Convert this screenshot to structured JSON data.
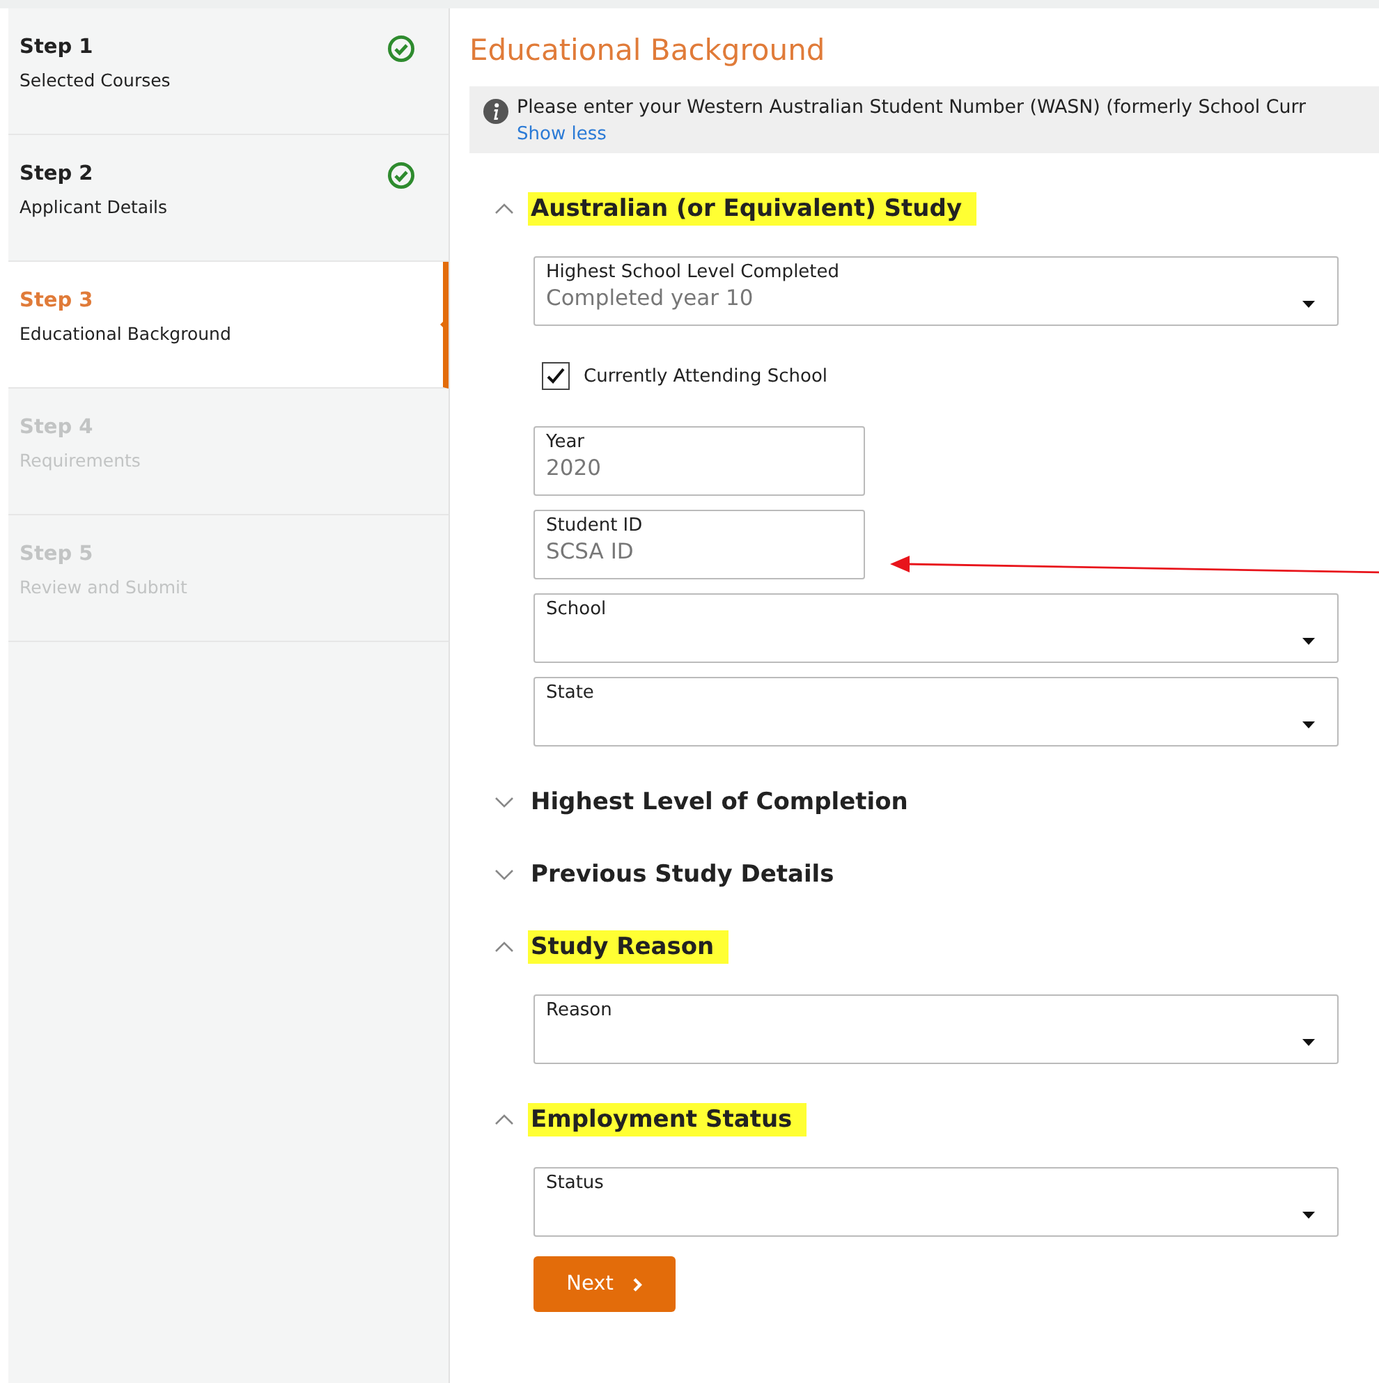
{
  "steps": [
    {
      "title": "Step 1",
      "subtitle": "Selected Courses",
      "completed": true,
      "selected": false,
      "disabled": false
    },
    {
      "title": "Step 2",
      "subtitle": "Applicant Details",
      "completed": true,
      "selected": false,
      "disabled": false
    },
    {
      "title": "Step 3",
      "subtitle": "Educational Background",
      "completed": false,
      "selected": true,
      "disabled": false
    },
    {
      "title": "Step 4",
      "subtitle": "Requirements",
      "completed": false,
      "selected": false,
      "disabled": true
    },
    {
      "title": "Step 5",
      "subtitle": "Review and Submit",
      "completed": false,
      "selected": false,
      "disabled": true
    }
  ],
  "page_title": "Educational Background",
  "info": {
    "text": "Please enter your Western Australian Student Number (WASN) (formerly School Curr",
    "link": "Show less"
  },
  "sections": [
    {
      "title": "Australian (or Equivalent) Study",
      "expanded": true,
      "highlighted": true,
      "fields": [
        {
          "kind": "select",
          "label": "Highest School Level Completed",
          "value": "Completed year 10"
        },
        {
          "kind": "checkbox",
          "label": "Currently Attending School",
          "checked": true
        },
        {
          "kind": "text",
          "label": "Year",
          "value": "2020"
        },
        {
          "kind": "text",
          "label": "Student ID",
          "placeholder": "SCSA ID"
        },
        {
          "kind": "select",
          "label": "School"
        },
        {
          "kind": "select",
          "label": "State"
        }
      ]
    },
    {
      "title": "Highest Level of Completion",
      "expanded": false,
      "highlighted": false
    },
    {
      "title": "Previous Study Details",
      "expanded": false,
      "highlighted": false
    },
    {
      "title": "Study Reason",
      "expanded": true,
      "highlighted": true,
      "fields": [
        {
          "kind": "select",
          "label": "Reason"
        }
      ]
    },
    {
      "title": "Employment Status",
      "expanded": true,
      "highlighted": true,
      "fields": [
        {
          "kind": "select",
          "label": "Status"
        }
      ]
    }
  ],
  "next_button": "Next"
}
